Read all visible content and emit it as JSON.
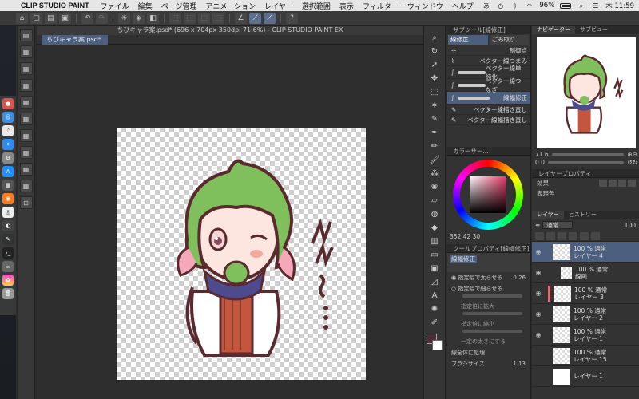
{
  "menubar": {
    "app_name": "CLIP STUDIO PAINT",
    "items": [
      "ファイル",
      "編集",
      "ページ管理",
      "アニメーション",
      "レイヤー",
      "選択範囲",
      "表示",
      "フィルター",
      "ウィンドウ",
      "ヘルプ"
    ],
    "battery": "96%",
    "clock": "木 11:59"
  },
  "document": {
    "title": "ちびキャラ案.psd* (696 x 704px 350dpi 71.6%) - CLIP STUDIO PAINT EX",
    "tab_label": "ちびキャラ案.psd*"
  },
  "subtool": {
    "header": "サブツール[線修正]",
    "tabs": [
      "線修正",
      "ごみ取り"
    ],
    "items": [
      {
        "label": "制御点",
        "type": "plain"
      },
      {
        "label": "ベクター線つまみ",
        "type": "plain"
      },
      {
        "label": "ベクター線単純化",
        "type": "stroke"
      },
      {
        "label": "ベクター線つなぎ",
        "type": "stroke"
      },
      {
        "label": "線幅修正",
        "type": "stroke",
        "selected": true
      },
      {
        "label": "ベクター線描き直し",
        "type": "plain"
      },
      {
        "label": "ベクター線幅描き直し",
        "type": "plain"
      }
    ]
  },
  "color_panel": {
    "header": "カラーサー...",
    "readout": "352 42 30",
    "main_color": "#4e2b36",
    "accent": "#e33b66"
  },
  "tool_property": {
    "header": "ツールプロパティ[線幅修正]",
    "tool_name": "線幅修正",
    "options": [
      {
        "label": "指定幅で太らせる",
        "value": "0.26",
        "sub": false
      },
      {
        "label": "指定幅で細らせる",
        "value": "",
        "sub": false
      },
      {
        "label": "指定倍に拡大",
        "value": "",
        "sub": true
      },
      {
        "label": "指定倍に縮小",
        "value": "",
        "sub": true
      },
      {
        "label": "一定の太さにする",
        "value": "",
        "sub": true
      },
      {
        "label": "線全体に処理",
        "value": "",
        "sub": false
      },
      {
        "label": "ブラシサイズ",
        "value": "1.13",
        "sub": false
      }
    ]
  },
  "navigator": {
    "tabs": [
      "ナビゲーター",
      "サブビュー"
    ],
    "zoom": "71.6",
    "rotation": "0.0"
  },
  "layer_property": {
    "header": "レイヤープロパティ",
    "effect_label": "効果",
    "display_color_label": "表現色"
  },
  "layers": {
    "tabs": [
      "レイヤー",
      "ヒストリー"
    ],
    "blend_mode": "通常",
    "opacity": "100",
    "rows": [
      {
        "mode": "100 % 通常",
        "name": "レイヤー 4",
        "selected": true,
        "folder": false,
        "mark": false
      },
      {
        "mode": "100 % 通常",
        "name": "線画",
        "selected": false,
        "folder": true,
        "mark": false
      },
      {
        "mode": "100 % 通常",
        "name": "レイヤー 3",
        "selected": false,
        "folder": false,
        "mark": true
      },
      {
        "mode": "100 % 通常",
        "name": "レイヤー 2",
        "selected": false,
        "folder": false,
        "mark": false
      },
      {
        "mode": "100 % 通常",
        "name": "レイヤー 1",
        "selected": false,
        "folder": false,
        "mark": false
      },
      {
        "mode": "100 % 通常",
        "name": "レイヤー 15",
        "selected": false,
        "folder": false,
        "mark": false
      },
      {
        "mode": "",
        "name": "レイヤー 1",
        "selected": false,
        "folder": false,
        "mark": false
      }
    ]
  },
  "canvas": {
    "sfx_text": "ん～…"
  }
}
